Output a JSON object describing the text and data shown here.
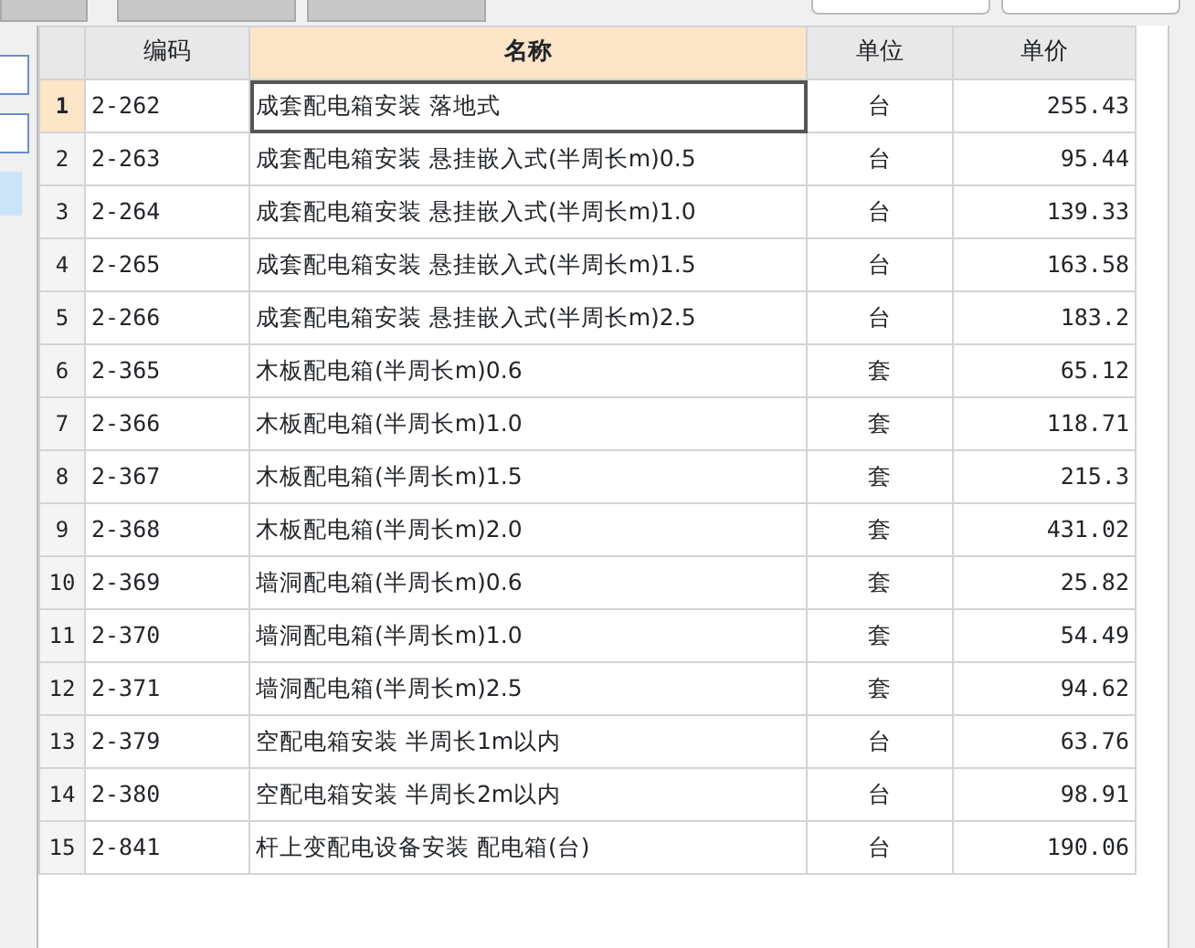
{
  "table": {
    "columns": [
      {
        "label": "编码",
        "selected": false
      },
      {
        "label": "名称",
        "selected": true
      },
      {
        "label": "单位",
        "selected": false
      },
      {
        "label": "单价",
        "selected": false
      }
    ],
    "rows": [
      {
        "index": "1",
        "code": "2-262",
        "name": "成套配电箱安装 落地式",
        "unit": "台",
        "price": "255.43",
        "selected": true
      },
      {
        "index": "2",
        "code": "2-263",
        "name": "成套配电箱安装 悬挂嵌入式(半周长m)0.5",
        "unit": "台",
        "price": "95.44",
        "selected": false
      },
      {
        "index": "3",
        "code": "2-264",
        "name": "成套配电箱安装 悬挂嵌入式(半周长m)1.0",
        "unit": "台",
        "price": "139.33",
        "selected": false
      },
      {
        "index": "4",
        "code": "2-265",
        "name": "成套配电箱安装 悬挂嵌入式(半周长m)1.5",
        "unit": "台",
        "price": "163.58",
        "selected": false
      },
      {
        "index": "5",
        "code": "2-266",
        "name": "成套配电箱安装 悬挂嵌入式(半周长m)2.5",
        "unit": "台",
        "price": "183.2",
        "selected": false
      },
      {
        "index": "6",
        "code": "2-365",
        "name": "木板配电箱(半周长m)0.6",
        "unit": "套",
        "price": "65.12",
        "selected": false
      },
      {
        "index": "7",
        "code": "2-366",
        "name": "木板配电箱(半周长m)1.0",
        "unit": "套",
        "price": "118.71",
        "selected": false
      },
      {
        "index": "8",
        "code": "2-367",
        "name": "木板配电箱(半周长m)1.5",
        "unit": "套",
        "price": "215.3",
        "selected": false
      },
      {
        "index": "9",
        "code": "2-368",
        "name": "木板配电箱(半周长m)2.0",
        "unit": "套",
        "price": "431.02",
        "selected": false
      },
      {
        "index": "10",
        "code": "2-369",
        "name": "墙洞配电箱(半周长m)0.6",
        "unit": "套",
        "price": "25.82",
        "selected": false
      },
      {
        "index": "11",
        "code": "2-370",
        "name": "墙洞配电箱(半周长m)1.0",
        "unit": "套",
        "price": "54.49",
        "selected": false
      },
      {
        "index": "12",
        "code": "2-371",
        "name": "墙洞配电箱(半周长m)2.5",
        "unit": "套",
        "price": "94.62",
        "selected": false
      },
      {
        "index": "13",
        "code": "2-379",
        "name": "空配电箱安装 半周长1m以内",
        "unit": "台",
        "price": "63.76",
        "selected": false
      },
      {
        "index": "14",
        "code": "2-380",
        "name": "空配电箱安装 半周长2m以内",
        "unit": "台",
        "price": "98.91",
        "selected": false
      },
      {
        "index": "15",
        "code": "2-841",
        "name": "杆上变配电设备安装 配电箱(台)",
        "unit": "台",
        "price": "190.06",
        "selected": false
      }
    ]
  }
}
